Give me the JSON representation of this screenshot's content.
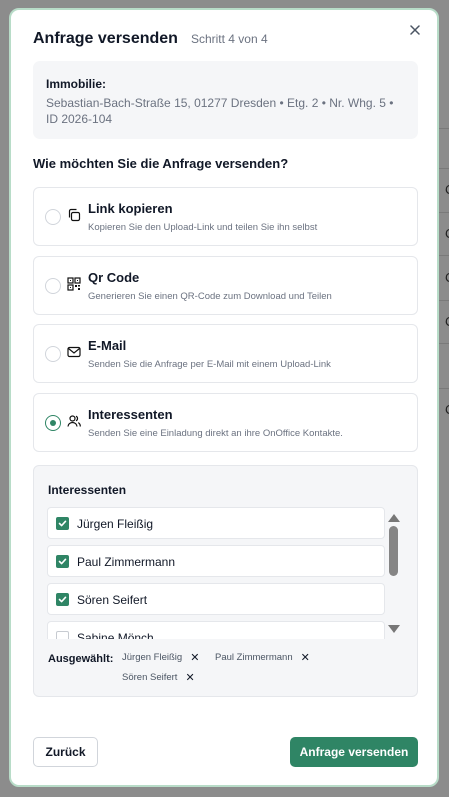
{
  "modal": {
    "title": "Anfrage versenden",
    "step": "Schritt 4 von 4"
  },
  "property": {
    "label": "Immobilie:",
    "value": "Sebastian-Bach-Straße 15, 01277 Dresden • Etg. 2 • Nr. Whg. 5 • ID 2026-104"
  },
  "question": "Wie möchten Sie die Anfrage versenden?",
  "options": [
    {
      "title": "Link kopieren",
      "description": "Kopieren Sie den Upload-Link und teilen Sie ihn selbst",
      "icon": "copy-icon",
      "selected": false
    },
    {
      "title": "Qr Code",
      "description": "Generieren Sie einen QR-Code zum Download und Teilen",
      "icon": "qr-code-icon",
      "selected": false
    },
    {
      "title": "E-Mail",
      "description": "Senden Sie die Anfrage per E-Mail mit einem Upload-Link",
      "icon": "mail-icon",
      "selected": false
    },
    {
      "title": "Interessenten",
      "description": "Senden Sie eine Einladung direkt an ihre OnOffice Kontakte.",
      "icon": "users-icon",
      "selected": true
    }
  ],
  "interessenten": {
    "title": "Interessenten",
    "items": [
      {
        "name": "Jürgen Fleißig",
        "checked": true
      },
      {
        "name": "Paul Zimmermann",
        "checked": true
      },
      {
        "name": "Sören Seifert",
        "checked": true
      },
      {
        "name": "Sabine Mönch",
        "checked": false
      }
    ],
    "selected_label": "Ausgewählt:",
    "selected": [
      "Jürgen Fleißig",
      "Paul Zimmermann",
      "Sören Seifert"
    ]
  },
  "buttons": {
    "back": "Zurück",
    "send": "Anfrage versenden"
  },
  "colors": {
    "accent": "#2f8565",
    "border": "#b8dcc8"
  }
}
